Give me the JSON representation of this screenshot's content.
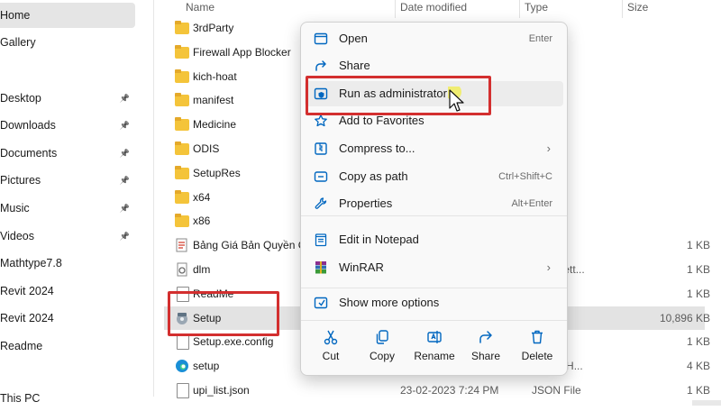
{
  "sidebar": {
    "items": [
      {
        "label": "Home",
        "pinned": false,
        "selected": true
      },
      {
        "label": "Gallery",
        "pinned": false
      },
      {
        "label": "Desktop",
        "pinned": true
      },
      {
        "label": "Downloads",
        "pinned": true
      },
      {
        "label": "Documents",
        "pinned": true
      },
      {
        "label": "Pictures",
        "pinned": true
      },
      {
        "label": "Music",
        "pinned": true
      },
      {
        "label": "Videos",
        "pinned": true
      },
      {
        "label": "Mathtype7.8",
        "pinned": false
      },
      {
        "label": "Revit 2024",
        "pinned": false
      },
      {
        "label": "Revit 2024",
        "pinned": false
      },
      {
        "label": "Readme",
        "pinned": false
      },
      {
        "label": "This PC",
        "pinned": false
      }
    ]
  },
  "columns": {
    "name": "Name",
    "date": "Date modified",
    "type": "Type",
    "size": "Size"
  },
  "files": [
    {
      "name": "3rdParty",
      "kind": "folder",
      "date": "",
      "type": "",
      "size": ""
    },
    {
      "name": "Firewall App Blocker",
      "kind": "folder",
      "date": "",
      "type": "",
      "size": ""
    },
    {
      "name": "kich-hoat",
      "kind": "folder",
      "date": "",
      "type": "",
      "size": ""
    },
    {
      "name": "manifest",
      "kind": "folder",
      "date": "",
      "type": "",
      "size": ""
    },
    {
      "name": "Medicine",
      "kind": "folder",
      "date": "",
      "type": "",
      "size": ""
    },
    {
      "name": "ODIS",
      "kind": "folder",
      "date": "",
      "type": "",
      "size": ""
    },
    {
      "name": "SetupRes",
      "kind": "folder",
      "date": "",
      "type": "",
      "size": ""
    },
    {
      "name": "x64",
      "kind": "folder",
      "date": "",
      "type": "",
      "size": ""
    },
    {
      "name": "x86",
      "kind": "folder",
      "date": "",
      "type": "",
      "size": ""
    },
    {
      "name": "Bảng Giá Bản Quyền Gia",
      "kind": "shortcut",
      "date": "",
      "type": "hortcut",
      "size": "1 KB"
    },
    {
      "name": "dlm",
      "kind": "settings",
      "date": "",
      "type": "ation sett...",
      "size": "1 KB"
    },
    {
      "name": "ReadMe",
      "kind": "doc",
      "date": "",
      "type": "ument",
      "size": "1 KB"
    },
    {
      "name": "Setup",
      "kind": "setup",
      "date": "",
      "type": "ion",
      "size": "10,896 KB",
      "selected": true
    },
    {
      "name": "Setup.exe.config",
      "kind": "doc",
      "date": "",
      "type": "File",
      "size": "1 KB"
    },
    {
      "name": "setup",
      "kind": "edge",
      "date": "",
      "type": "t Edge H...",
      "size": "4 KB"
    },
    {
      "name": "upi_list.json",
      "kind": "doc",
      "date": "23-02-2023 7:24 PM",
      "type": "JSON File",
      "size": "1 KB"
    }
  ],
  "context_menu": {
    "items": [
      {
        "label": "Open",
        "shortcut": "Enter",
        "icon": "open-icon"
      },
      {
        "label": "Share",
        "shortcut": "",
        "icon": "share-icon"
      },
      {
        "label": "Run as administrator",
        "shortcut": "",
        "icon": "shield-icon",
        "highlighted": true
      },
      {
        "label": "Add to Favorites",
        "shortcut": "",
        "icon": "star-icon"
      },
      {
        "label": "Compress to...",
        "shortcut": "",
        "icon": "zip-icon",
        "submenu": true
      },
      {
        "label": "Copy as path",
        "shortcut": "Ctrl+Shift+C",
        "icon": "copy-path-icon"
      },
      {
        "label": "Properties",
        "shortcut": "Alt+Enter",
        "icon": "wrench-icon"
      },
      {
        "label": "Edit in Notepad",
        "shortcut": "",
        "icon": "notepad-icon"
      },
      {
        "label": "WinRAR",
        "shortcut": "",
        "icon": "winrar-icon",
        "submenu": true
      },
      {
        "label": "Show more options",
        "shortcut": "",
        "icon": "more-options-icon"
      }
    ],
    "quick_actions": [
      {
        "label": "Cut",
        "icon": "scissors-icon"
      },
      {
        "label": "Copy",
        "icon": "copy-icon"
      },
      {
        "label": "Rename",
        "icon": "rename-icon"
      },
      {
        "label": "Share",
        "icon": "share-icon"
      },
      {
        "label": "Delete",
        "icon": "trash-icon"
      }
    ],
    "submenu_glyph": "›"
  },
  "colors": {
    "highlight_box": "#d32f2f",
    "folder": "#f4c43a",
    "accent": "#0067c0"
  }
}
